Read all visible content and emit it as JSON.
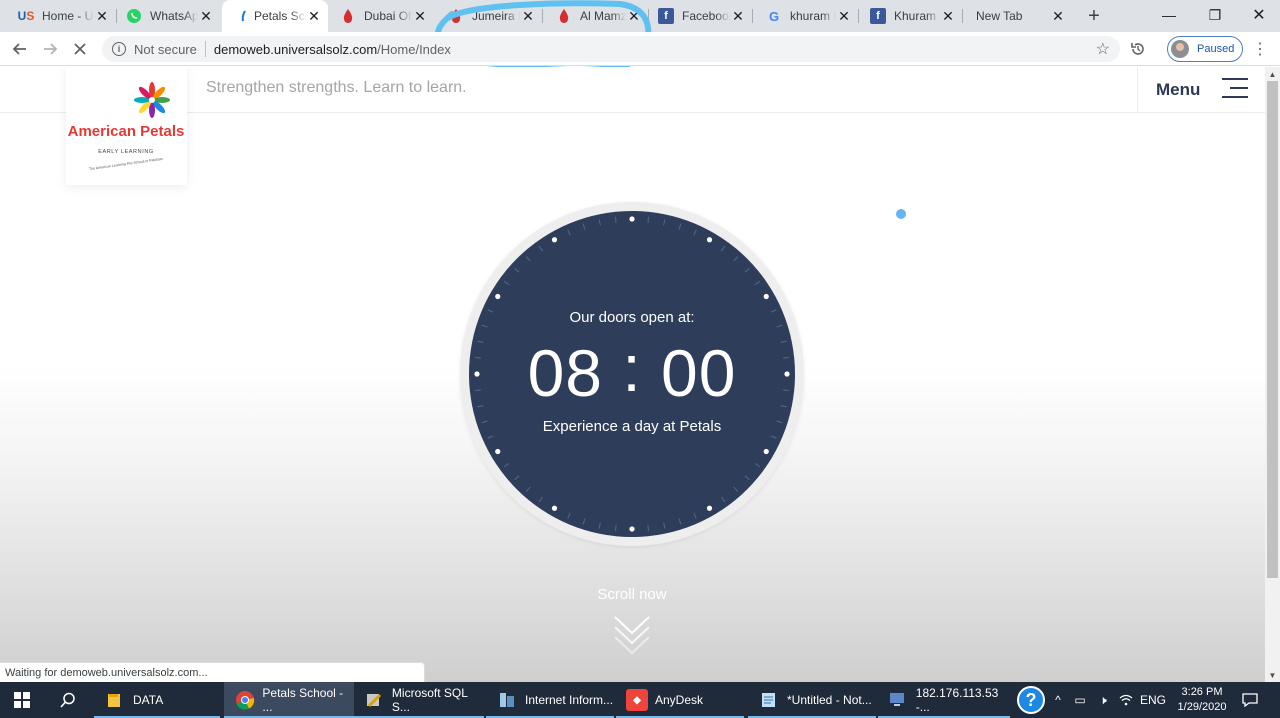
{
  "browser": {
    "tabs": [
      {
        "title": "Home - U",
        "icon": "us-logo-icon"
      },
      {
        "title": "WhatsApp",
        "icon": "whatsapp-icon"
      },
      {
        "title": "Petals Sch",
        "icon": "petals-favicon",
        "active": true
      },
      {
        "title": "Dubai Of",
        "icon": "red-drop-icon"
      },
      {
        "title": "Jumeira P",
        "icon": "red-drop-icon"
      },
      {
        "title": "Al Mamz",
        "icon": "red-drop-icon"
      },
      {
        "title": "Facebook",
        "icon": "facebook-icon"
      },
      {
        "title": "khuram h",
        "icon": "google-icon"
      },
      {
        "title": "Khuram K",
        "icon": "facebook-icon"
      },
      {
        "title": "New Tab",
        "icon": ""
      }
    ],
    "new_tab_symbol": "+",
    "window_controls": {
      "minimize": "—",
      "restore": "❐",
      "close": "✕"
    },
    "address": {
      "security_label": "Not secure",
      "url_host": "demoweb.universalsolz.com",
      "url_path": "/Home/Index"
    },
    "profile_label": "Paused",
    "status_text": "Waiting for demoweb.universalsolz.com...",
    "annotation_color": "#5fc1f0"
  },
  "site": {
    "logo": {
      "brand": "American Petals",
      "sub": "EARLY LEARNING",
      "tagline_small": "The American Learning Pre-School in Pakistan"
    },
    "tagline": "Strengthen strengths. Learn to learn.",
    "menu_label": "Menu",
    "clock": {
      "open_text": "Our doors open at:",
      "hours": "08",
      "separator": ":",
      "minutes": "00",
      "experience_text": "Experience a day at Petals"
    },
    "scroll_text": "Scroll now",
    "colors": {
      "clock_face": "#2e3d5a",
      "accent_dot": "#64b5f6",
      "menu_text": "#2d3a57"
    }
  },
  "taskbar": {
    "items": [
      {
        "label": "DATA",
        "icon": "folder-icon"
      },
      {
        "label": "Petals School - ...",
        "icon": "chrome-icon",
        "active": true
      },
      {
        "label": "Microsoft SQL S...",
        "icon": "sql-server-icon"
      },
      {
        "label": "Internet Inform...",
        "icon": "iis-icon"
      },
      {
        "label": "AnyDesk",
        "icon": "anydesk-icon"
      },
      {
        "label": "*Untitled - Not...",
        "icon": "notepad-icon"
      },
      {
        "label": "182.176.113.53 -...",
        "icon": "remote-desktop-icon"
      }
    ],
    "tray": {
      "language": "ENG",
      "time": "3:26 PM",
      "date": "1/29/2020"
    }
  }
}
